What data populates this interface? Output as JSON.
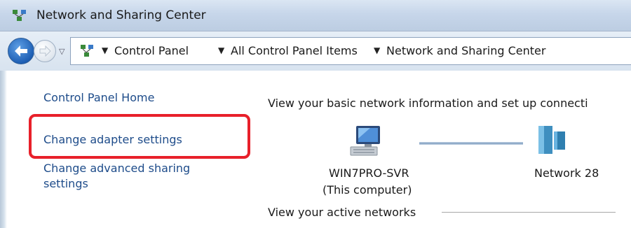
{
  "window": {
    "title": "Network and Sharing Center"
  },
  "navigation": {
    "history_arrow": "▽",
    "breadcrumbs": [
      {
        "label": "Control Panel"
      },
      {
        "label": "All Control Panel Items"
      },
      {
        "label": "Network and Sharing Center"
      }
    ]
  },
  "sidebar": {
    "items": [
      {
        "label": "Control Panel Home"
      },
      {
        "label": "Change adapter settings"
      },
      {
        "label_line1": "Change advanced sharing",
        "label_line2": "settings"
      }
    ]
  },
  "main": {
    "heading": "View your basic network information and set up connecti",
    "computer": {
      "name": "WIN7PRO-SVR",
      "subtitle": "(This computer)"
    },
    "network": {
      "name": "Network  28"
    },
    "active_networks_heading": "View your active networks"
  },
  "icons": {
    "title": "network-center-icon",
    "back": "back-arrow-icon",
    "forward": "forward-arrow-icon",
    "address": "network-center-icon",
    "computer": "computer-icon",
    "network": "network-icon"
  },
  "colors": {
    "link": "#1e4c8a",
    "highlight": "#e8202a"
  }
}
